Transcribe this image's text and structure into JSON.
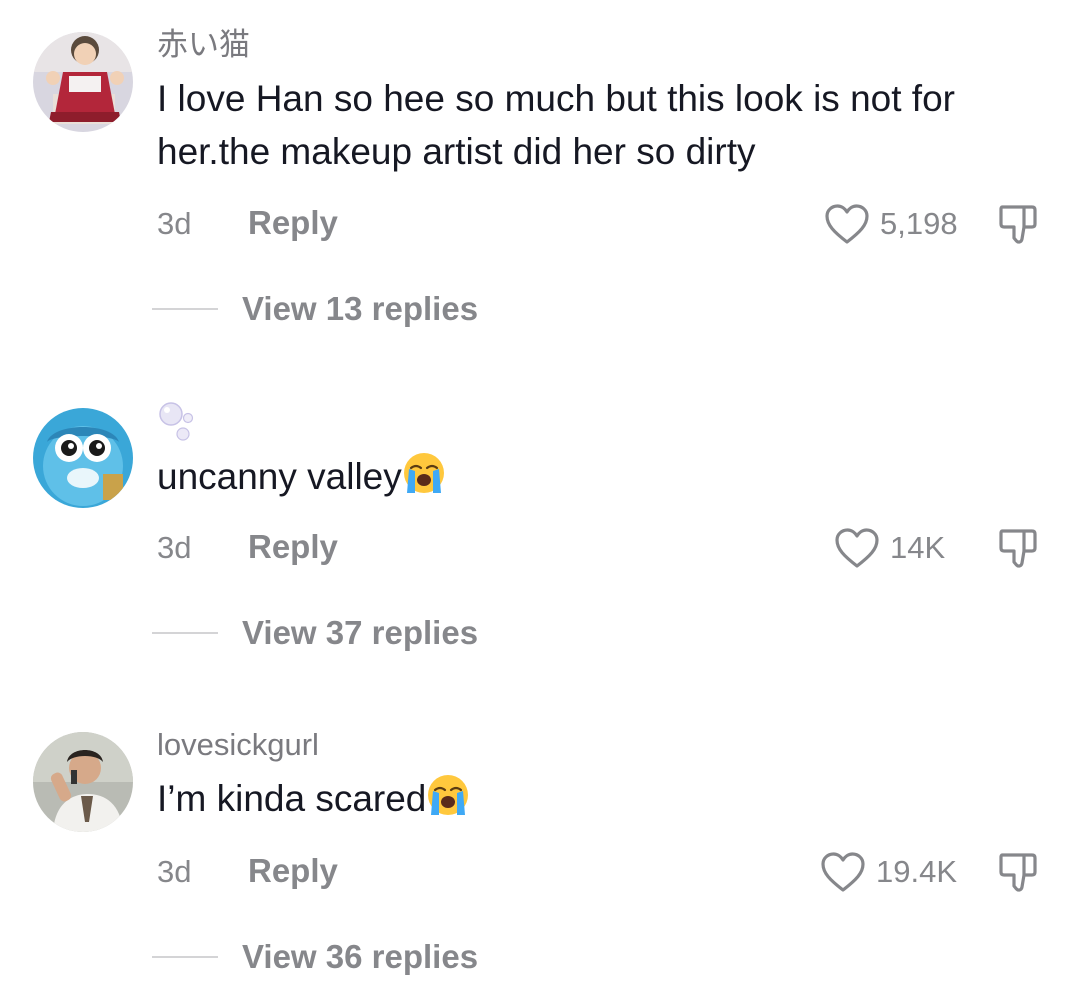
{
  "comments": [
    {
      "username": "赤い猫",
      "text": "I love Han so hee so much but this look is not for her.the makeup artist did her so dirty",
      "time": "3d",
      "reply_label": "Reply",
      "likes": "5,198",
      "view_replies": "View 13 replies",
      "avatar_icon": "cartoon-girl-red-dress-avatar"
    },
    {
      "username": "",
      "username_icon": "bubbles-icon",
      "text": "uncanny valley",
      "emoji": "loudly-crying-face-emoji",
      "time": "3d",
      "reply_label": "Reply",
      "likes": "14K",
      "view_replies": "View 37 replies",
      "avatar_icon": "blue-cartoon-creature-avatar"
    },
    {
      "username": "lovesickgurl",
      "text": "I’m kinda scared",
      "emoji": "loudly-crying-face-emoji",
      "time": "3d",
      "reply_label": "Reply",
      "likes": "19.4K",
      "view_replies": "View 36 replies",
      "avatar_icon": "person-singing-photo-avatar"
    }
  ],
  "colors": {
    "primary_text": "#161823",
    "secondary_text": "#86878b",
    "divider": "#d4d4d6",
    "background": "#ffffff"
  }
}
